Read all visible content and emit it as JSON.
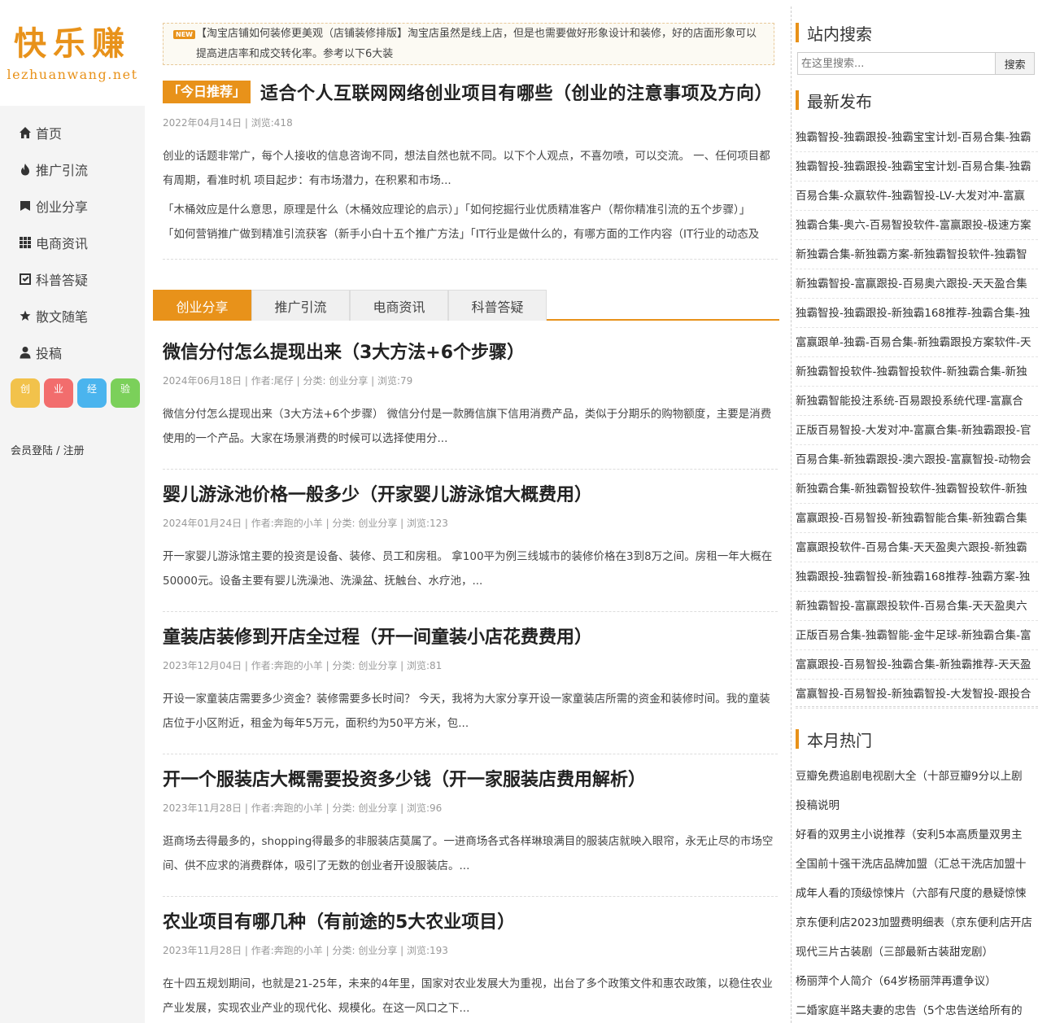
{
  "logo": {
    "cn": "快乐赚",
    "en": "lezhuanwang.net"
  },
  "nav": [
    {
      "label": "首页",
      "icon": "home-icon"
    },
    {
      "label": "推广引流",
      "icon": "fire-icon"
    },
    {
      "label": "创业分享",
      "icon": "bookmark-icon"
    },
    {
      "label": "电商资讯",
      "icon": "grid-icon"
    },
    {
      "label": "科普答疑",
      "icon": "checkbox-icon"
    },
    {
      "label": "散文随笔",
      "icon": "star-icon"
    },
    {
      "label": "投稿",
      "icon": "user-icon"
    }
  ],
  "tags": [
    "创",
    "业",
    "经",
    "验"
  ],
  "member": "会员登陆 / 注册",
  "notice": {
    "badge": "NEW",
    "text": "【淘宝店铺如何装修更美观（店铺装修排版】淘宝店虽然是线上店，但是也需要做好形象设计和装修，好的店面形象可以提高进店率和成交转化率。参考以下6大装"
  },
  "featured": {
    "tag": "「今日推荐」",
    "title": "适合个人互联网网络创业项目有哪些（创业的注意事项及方向）",
    "meta": "2022年04月14日 | 浏览:418",
    "excerpt": "创业的话题非常广，每个人接收的信息咨询不同，想法自然也就不同。以下个人观点，不喜勿喷，可以交流。 一、任何项目都有周期，看准时机 项目起步：有市场潜力，在积累和市场...",
    "related1": "「木桶效应是什么意思，原理是什么（木桶效应理论的启示）」「如何挖掘行业优质精准客户（帮你精准引流的五个步骤）」",
    "related2": "「如何营销推广做到精准引流获客（新手小白十五个推广方法」「IT行业是做什么的，有哪方面的工作内容（IT行业的动态及"
  },
  "tabs": [
    "创业分享",
    "推广引流",
    "电商资讯",
    "科普答疑"
  ],
  "posts": [
    {
      "title": "微信分付怎么提现出来（3大方法+6个步骤）",
      "meta": "2024年06月18日 | 作者:尾仔 | 分类: 创业分享 | 浏览:79",
      "excerpt": "微信分付怎么提现出来（3大方法+6个步骤） 微信分付是一款腾信旗下信用消费产品，类似于分期乐的购物额度，主要是消费使用的一个产品。大家在场景消费的时候可以选择使用分..."
    },
    {
      "title": "婴儿游泳池价格一般多少（开家婴儿游泳馆大概费用）",
      "meta": "2024年01月24日 | 作者:奔跑的小羊 | 分类: 创业分享 | 浏览:123",
      "excerpt": "开一家婴儿游泳馆主要的投资是设备、装修、员工和房租。 拿100平为例三线城市的装修价格在3到8万之间。房租一年大概在50000元。设备主要有婴儿洗澡池、洗澡盆、抚触台、水疗池，..."
    },
    {
      "title": "童装店装修到开店全过程（开一间童装小店花费费用）",
      "meta": "2023年12月04日 | 作者:奔跑的小羊 | 分类: 创业分享 | 浏览:81",
      "excerpt": "开设一家童装店需要多少资金？装修需要多长时间？ 今天，我将为大家分享开设一家童装店所需的资金和装修时间。我的童装店位于小区附近，租金为每年5万元，面积约为50平方米，包..."
    },
    {
      "title": "开一个服装店大概需要投资多少钱（开一家服装店费用解析）",
      "meta": "2023年11月28日 | 作者:奔跑的小羊 | 分类: 创业分享 | 浏览:96",
      "excerpt": "逛商场去得最多的，shopping得最多的非服装店莫属了。一进商场各式各样琳琅满目的服装店就映入眼帘，永无止尽的市场空间、供不应求的消费群体，吸引了无数的创业者开设服装店。..."
    },
    {
      "title": "农业项目有哪几种（有前途的5大农业项目）",
      "meta": "2023年11月28日 | 作者:奔跑的小羊 | 分类: 创业分享 | 浏览:193",
      "excerpt": "在十四五规划期间，也就是21-25年，未来的4年里，国家对农业发展大为重视，出台了多个政策文件和惠农政策，以稳住农业产业发展，实现农业产业的现代化、规模化。在这一风口之下..."
    }
  ],
  "search": {
    "title": "站内搜索",
    "placeholder": "在这里搜索...",
    "button": "搜索"
  },
  "latest": {
    "title": "最新发布",
    "items": [
      "独霸智投-独霸跟投-独霸宝宝计划-百易合集-独霸",
      "独霸智投-独霸跟投-独霸宝宝计划-百易合集-独霸",
      "百易合集-众赢软件-独霸智投-LV-大发对冲-富赢",
      "独霸合集-奥六-百易智投软件-富赢跟投-极速方案",
      "新独霸合集-新独霸方案-新独霸智投软件-独霸智",
      "新独霸智投-富赢跟投-百易奥六跟投-天天盈合集",
      "独霸智投-独霸跟投-新独霸168推荐-独霸合集-独",
      "富赢跟单-独霸-百易合集-新独霸跟投方案软件-天",
      "新独霸智投软件-独霸智投软件-新独霸合集-新独",
      "新独霸智能投注系统-百易跟投系统代理-富赢合",
      "正版百易智投-大发对冲-富赢合集-新独霸跟投-官",
      "百易合集-新独霸跟投-澳六跟投-富赢智投-动物会",
      "新独霸合集-新独霸智投软件-独霸智投软件-新独",
      "富赢跟投-百易智投-新独霸智能合集-新独霸合集",
      "富赢跟投软件-百易合集-天天盈奥六跟投-新独霸",
      "独霸跟投-独霸智投-新独霸168推荐-独霸方案-独",
      "新独霸智投-富赢跟投软件-百易合集-天天盈奥六",
      "正版百易合集-独霸智能-金牛足球-新独霸合集-富",
      "富赢跟投-百易智投-独霸合集-新独霸推荐-天天盈",
      "富赢智投-百易智投-新独霸智投-大发智投-跟投合"
    ]
  },
  "hot": {
    "title": "本月热门",
    "items": [
      "豆瓣免费追剧电视剧大全（十部豆瓣9分以上剧",
      "投稿说明",
      "好看的双男主小说推荐（安利5本高质量双男主",
      "全国前十强干洗店品牌加盟（汇总干洗店加盟十",
      "成年人看的顶级惊悚片（六部有尺度的悬疑惊悚",
      "京东便利店2023加盟费明细表（京东便利店开店",
      "现代三片古装剧（三部最新古装甜宠剧）",
      "杨丽萍个人简介（64岁杨丽萍再遭争议）",
      "二婚家庭半路夫妻的忠告（5个忠告送给所有的"
    ]
  },
  "colors": {
    "accent": "#e8921a"
  }
}
